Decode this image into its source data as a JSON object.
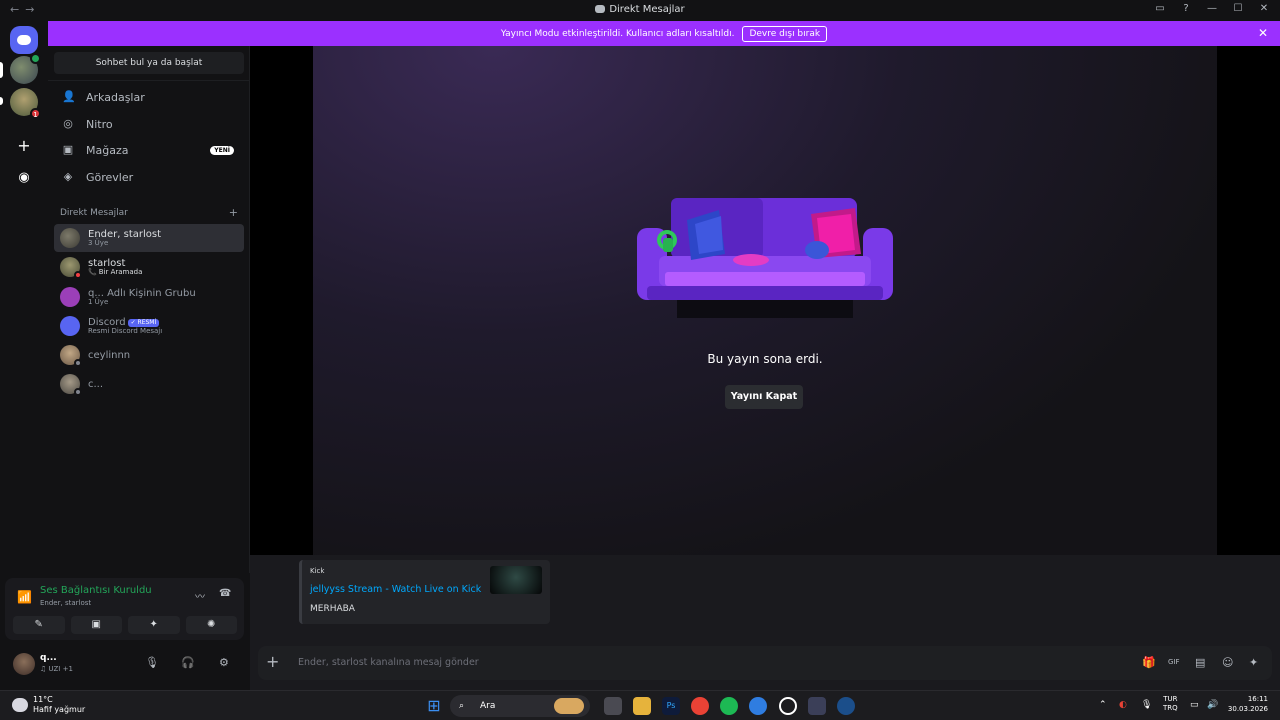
{
  "titlebar": {
    "nav_back": "←",
    "nav_forward": "→",
    "title": "Direkt Mesajlar",
    "inbox_icon": "inbox-icon",
    "help_icon": "help-icon",
    "minimize": "—",
    "maximize": "☐",
    "close": "✕"
  },
  "banner": {
    "text": "Yayıncı Modu etkinleştirildi. Kullanıcı adları kısaltıldı.",
    "button": "Devre dışı bırak",
    "close": "✕"
  },
  "rail": {
    "badge_count": "1",
    "add_server": "+",
    "discover": "◉"
  },
  "sidebar": {
    "search_label": "Sohbet bul ya da başlat",
    "nav": [
      {
        "label": "Arkadaşlar",
        "icon": "👤"
      },
      {
        "label": "Nitro",
        "icon": "◎"
      },
      {
        "label": "Mağaza",
        "icon": "▣",
        "badge": "YENİ"
      },
      {
        "label": "Görevler",
        "icon": "◈"
      }
    ],
    "dm_header": "Direkt Mesajlar",
    "dm_add": "+",
    "dms": [
      {
        "name": "Ender, starlost",
        "sub": "3 Üye"
      },
      {
        "name": "starlost",
        "sub": "Bir Aramada",
        "sub_icon": "📞"
      },
      {
        "name": "q... Adlı Kişinin Grubu",
        "sub": "1 Üye"
      },
      {
        "name": "Discord",
        "badge": "✓ RESMİ",
        "sub": "Resmi Discord Mesajı"
      },
      {
        "name": "ceylinnn",
        "sub": ""
      },
      {
        "name": "c...",
        "sub": ""
      }
    ]
  },
  "voice": {
    "title": "Ses Bağlantısı Kuruldu",
    "subtitle": "Ender, starlost",
    "icons": [
      "〰",
      "☎"
    ],
    "buttons": [
      "✎",
      "▣",
      "✦",
      "✺"
    ]
  },
  "user": {
    "name": "q...",
    "status": "♫ UZI +1",
    "mic": "🎙",
    "headset": "🎧",
    "settings": "⚙"
  },
  "stream": {
    "message": "Bu yayın sona erdi.",
    "button": "Yayını Kapat"
  },
  "embed": {
    "provider": "Kick",
    "title": "jellyyss Stream - Watch Live on Kick",
    "description": "MERHABA"
  },
  "composer": {
    "plus": "+",
    "placeholder": "Ender, starlost kanalına mesaj gönder",
    "icons": [
      "🎁",
      "GIF",
      "▤",
      "☺",
      "✦"
    ]
  },
  "taskbar": {
    "temp": "11°C",
    "weather": "Hafif yağmur",
    "search": "Ara",
    "lang_top": "TUR",
    "lang_bottom": "TRQ",
    "time": "16:11",
    "date": "30.03.2026"
  },
  "colors": {
    "banner": "#9b30ff",
    "blurple": "#5865f2",
    "green": "#23a559",
    "link": "#00a8fc",
    "background": "#121214"
  }
}
